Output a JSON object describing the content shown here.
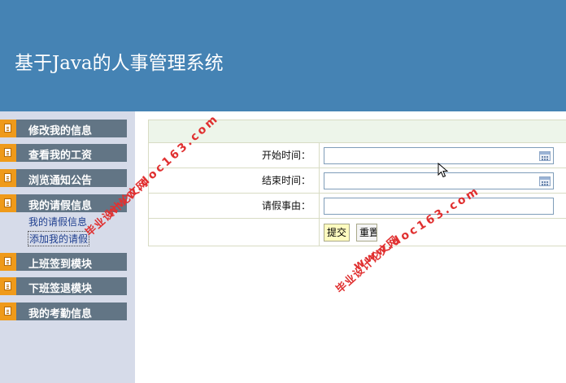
{
  "header": {
    "title": "基于Java的人事管理系统"
  },
  "sidebar": {
    "items": [
      {
        "label": "修改我的信息"
      },
      {
        "label": "查看我的工资"
      },
      {
        "label": "浏览通知公告"
      },
      {
        "label": "我的请假信息"
      },
      {
        "label": "上班签到模块"
      },
      {
        "label": "下班签退模块"
      },
      {
        "label": "我的考勤信息"
      }
    ],
    "sub_items": [
      {
        "label": "我的请假信息"
      },
      {
        "label": "添加我的请假"
      }
    ]
  },
  "form": {
    "fields": [
      {
        "label": "开始时间：",
        "value": ""
      },
      {
        "label": "结束时间：",
        "value": ""
      },
      {
        "label": "请假事由：",
        "value": ""
      }
    ],
    "submit_label": "提交",
    "reset_label": "重置"
  },
  "watermarks": {
    "text1": "毕业设计论文网",
    "url1": "www.doc163.com",
    "text2": "毕业设计论文网",
    "url2": "www.doc163.com"
  },
  "colors": {
    "header": "#4583b4",
    "sidebar_bg": "#d6dbe9",
    "menu_bg": "#627585",
    "menu_icon": "#ef9a1a",
    "watermark": "#e03030"
  }
}
